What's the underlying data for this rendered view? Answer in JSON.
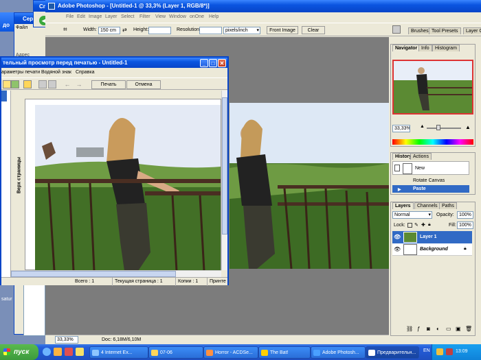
{
  "photoshop": {
    "title": "Adobe Photoshop - [Untitled-1 @ 33,3% (Layer 1, RGB/8*)]",
    "menu": [
      "File",
      "Edit",
      "Image",
      "Layer",
      "Select",
      "Filter",
      "View",
      "Window",
      "onOne",
      "Help"
    ],
    "options": {
      "width_label": "Width:",
      "width_value": "150 cm",
      "height_label": "Height:",
      "height_value": "",
      "resolution_label": "Resolution:",
      "resolution_value": "",
      "resolution_unit": "pixels/inch",
      "front_image": "Front Image",
      "clear": "Clear"
    },
    "dock_tabs": [
      "Brushes",
      "Tool Presets",
      "Layer C"
    ],
    "status": {
      "zoom": "33,33%",
      "doc": "Doc: 6,18M/6,10M"
    }
  },
  "navigator": {
    "tabs": [
      "Navigator",
      "Info",
      "Histogram"
    ],
    "zoom": "33,33%"
  },
  "history": {
    "tabs": [
      "History",
      "Actions"
    ],
    "snapshot": "New",
    "items": [
      "Rotate Canvas",
      "Paste"
    ]
  },
  "layers": {
    "tabs": [
      "Layers",
      "Channels",
      "Paths"
    ],
    "blend_mode": "Normal",
    "opacity_label": "Opacity:",
    "opacity": "100%",
    "lock_label": "Lock:",
    "fill_label": "Fill:",
    "fill": "100%",
    "items": [
      "Layer 1",
      "Background"
    ]
  },
  "preview": {
    "title": "тельный просмотр перед печатью - Untitled-1",
    "menu": [
      "араметры печати",
      "Водяной знак",
      "Справка"
    ],
    "print_button": "Печать",
    "cancel_button": "Отмена",
    "ruler_label": "Верх страницы",
    "status": {
      "total": "Всего : 1",
      "current": "Текущая страница : 1",
      "copies": "Копии : 1",
      "printer": "Принте"
    }
  },
  "background_windows": {
    "win1": "до",
    "win2": "Сере",
    "win3": "Сп",
    "win2_menu": "Файл",
    "address": "Адрес",
    "left_text": "satur"
  },
  "taskbar": {
    "start": "пуск",
    "items": [
      "4 Internet Ex...",
      "07-06",
      "Horror - ACDSe...",
      "The Bat!",
      "Adobe Photosh...",
      "Предварительн..."
    ],
    "lang": "EN",
    "clock": "13:09"
  },
  "colors": {
    "xp_blue": "#0a55e0",
    "taskbar": "#245edb",
    "start_green": "#3c9a3c",
    "selection": "#316ac5"
  }
}
